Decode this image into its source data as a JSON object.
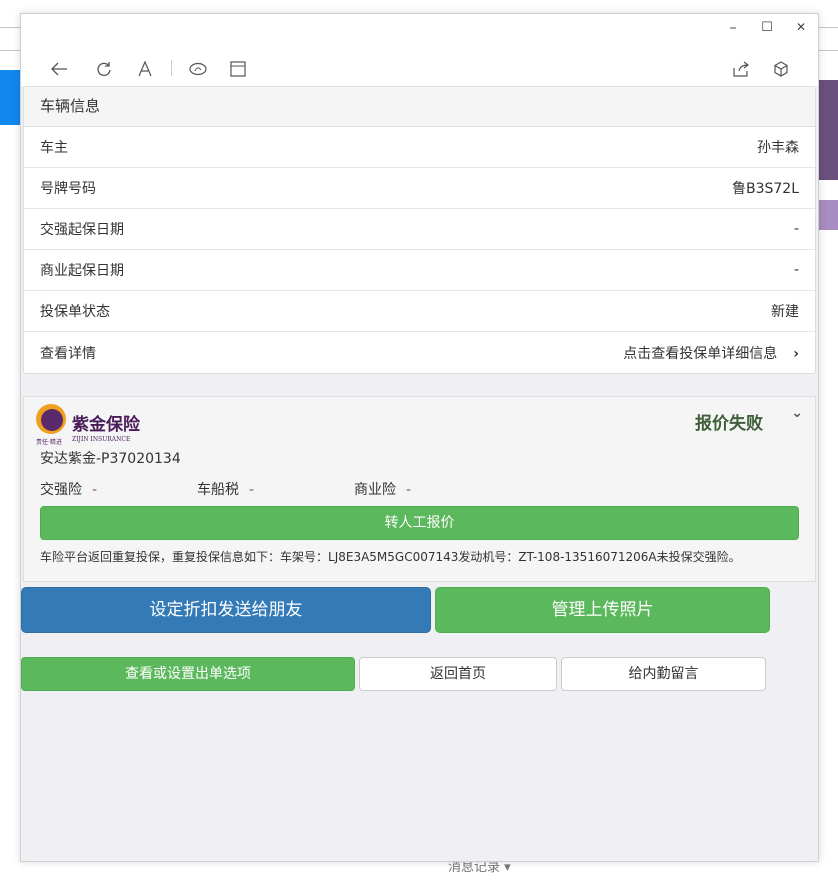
{
  "window": {
    "minimize": "–",
    "maximize": "☐",
    "close": "✕"
  },
  "vehicle": {
    "title": "车辆信息",
    "rows": [
      {
        "label": "车主",
        "value": "孙丰森"
      },
      {
        "label": "号牌号码",
        "value": "鲁B3S72L"
      },
      {
        "label": "交强起保日期",
        "value": "-"
      },
      {
        "label": "商业起保日期",
        "value": "-"
      },
      {
        "label": "投保单状态",
        "value": "新建"
      },
      {
        "label": "查看详情",
        "value": "点击查看投保单详细信息"
      }
    ]
  },
  "quote": {
    "logo_text": "紫金保险",
    "logo_sub": "ZIJIN INSURANCE",
    "logo_slogan": "责任·精进",
    "status": "报价失败",
    "id": "安达紫金-P37020134",
    "fees": [
      {
        "label": "交强险",
        "value": "-"
      },
      {
        "label": "车船税",
        "value": "-"
      },
      {
        "label": "商业险",
        "value": "-"
      }
    ],
    "manual_button": "转人工报价",
    "note": "车险平台返回重复投保，重复投保信息如下：车架号：LJ8E3A5M5GC007143发动机号：ZT-108-13516071206A未投保交强险。"
  },
  "actions": {
    "discount": "设定折扣发送给朋友",
    "photos": "管理上传照片",
    "options": "查看或设置出单选项",
    "home": "返回首页",
    "message": "给内勤留言"
  },
  "background": {
    "bottom_text": "消息记录 ▾"
  },
  "colors": {
    "green": "#5cb85c",
    "blue": "#337ab7",
    "status": "#3f5e3a"
  }
}
